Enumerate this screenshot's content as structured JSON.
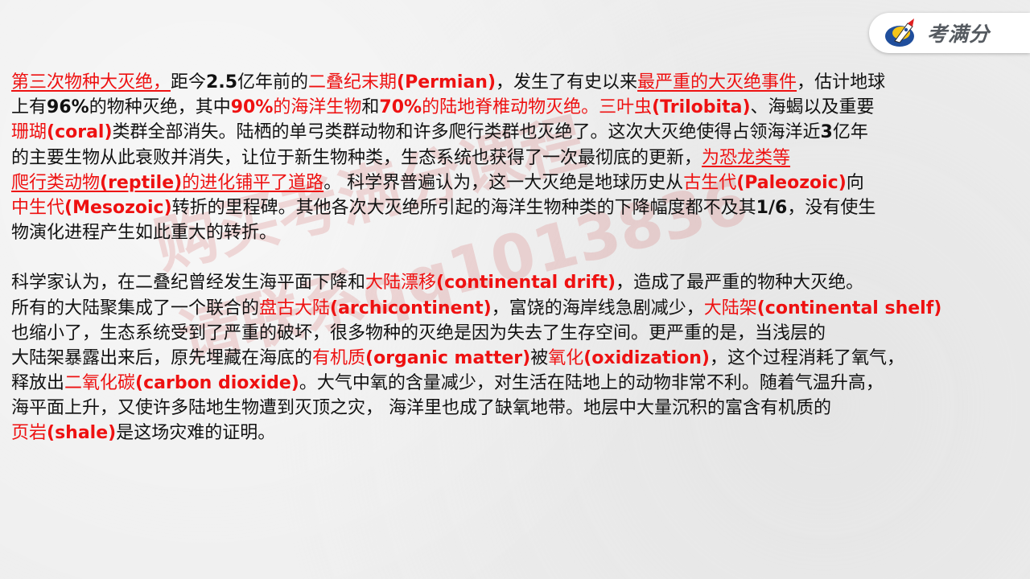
{
  "logo": {
    "text": "考满分"
  },
  "paragraph1": [
    [
      {
        "t": "第三次物种大灭绝，",
        "red": true,
        "u": true
      },
      {
        "t": "距今"
      },
      {
        "t": "2.5",
        "b": true
      },
      {
        "t": "亿年前的"
      },
      {
        "t": "二叠纪末期",
        "red": true
      },
      {
        "t": "(Permian)",
        "red": true,
        "b": true
      },
      {
        "t": "，发生了有史以来"
      },
      {
        "t": "最严重的大灭绝事件",
        "red": true,
        "u": true
      },
      {
        "t": "，估计地球"
      }
    ],
    [
      {
        "t": "上有"
      },
      {
        "t": "96%",
        "b": true
      },
      {
        "t": "的物种灭绝，其中"
      },
      {
        "t": "90%",
        "red": true,
        "b": true
      },
      {
        "t": "的海洋生物",
        "red": true
      },
      {
        "t": "和"
      },
      {
        "t": "70%",
        "red": true,
        "b": true
      },
      {
        "t": "的陆地脊椎动物灭绝。",
        "red": true
      },
      {
        "t": "三叶虫",
        "red": true
      },
      {
        "t": "(Trilobita)",
        "red": true,
        "b": true
      },
      {
        "t": "、海蝎以及重要"
      }
    ],
    [
      {
        "t": "珊瑚",
        "red": true
      },
      {
        "t": "(coral)",
        "red": true,
        "b": true
      },
      {
        "t": "类群全部消失。陆栖的单弓类群动物和许多爬行类群也灭绝了。这次大灭绝使得占领海洋近"
      },
      {
        "t": "3",
        "b": true
      },
      {
        "t": "亿年"
      }
    ],
    [
      {
        "t": "的主要生物从此衰败并消失，让位于新生物种类，生态系统也获得了一次最彻底的更新，"
      },
      {
        "t": "为恐龙类等",
        "red": true,
        "u": true
      }
    ],
    [
      {
        "t": "爬行类动物",
        "red": true,
        "u": true
      },
      {
        "t": "(reptile)",
        "red": true,
        "u": true,
        "b": true
      },
      {
        "t": "的进化铺平了道路",
        "red": true,
        "u": true
      },
      {
        "t": "。 科学界普遍认为，这一大灭绝是地球历史从"
      },
      {
        "t": "古生代",
        "red": true
      },
      {
        "t": "(Paleozoic)",
        "red": true,
        "b": true
      },
      {
        "t": "向"
      }
    ],
    [
      {
        "t": "中生代",
        "red": true
      },
      {
        "t": "(Mesozoic)",
        "red": true,
        "b": true
      },
      {
        "t": "转折的里程碑。其他各次大灭绝所引起的海洋生物种类的下降幅度都不及其"
      },
      {
        "t": "1/6",
        "b": true
      },
      {
        "t": "，没有使生"
      }
    ],
    [
      {
        "t": "物演化进程产生如此重大的转折。"
      }
    ]
  ],
  "paragraph2": [
    [
      {
        "t": "科学家认为，在二叠纪曾经发生海平面下降和"
      },
      {
        "t": "大陆漂移",
        "red": true
      },
      {
        "t": "(continental drift)",
        "red": true,
        "b": true
      },
      {
        "t": "，造成了最严重的物种大灭绝。"
      }
    ],
    [
      {
        "t": "所有的大陆聚集成了一个联合的"
      },
      {
        "t": "盘古大陆",
        "red": true
      },
      {
        "t": "(archicontinent)",
        "red": true,
        "b": true
      },
      {
        "t": "，富饶的海岸线急剧减少，"
      },
      {
        "t": "大陆架",
        "red": true
      },
      {
        "t": "(continental shelf)",
        "red": true,
        "b": true
      }
    ],
    [
      {
        "t": "也缩小了，生态系统受到了严重的破坏，很多物种的灭绝是因为失去了生存空间。更严重的是，当浅层的"
      }
    ],
    [
      {
        "t": "大陆架暴露出来后，原先埋藏在海底的"
      },
      {
        "t": "有机质",
        "red": true
      },
      {
        "t": "(organic matter)",
        "red": true,
        "b": true
      },
      {
        "t": "被"
      },
      {
        "t": "氧化",
        "red": true
      },
      {
        "t": "(oxidization)",
        "red": true,
        "b": true
      },
      {
        "t": "，这个过程消耗了氧气，"
      }
    ],
    [
      {
        "t": "释放出"
      },
      {
        "t": "二氧化碳",
        "red": true
      },
      {
        "t": "(carbon dioxide)",
        "red": true,
        "b": true
      },
      {
        "t": "。大气中氧的含量减少，对生活在陆地上的动物非常不利。随着气温升高，"
      }
    ],
    [
      {
        "t": "海平面上升，又使许多陆地生物遭到灭顶之灾， 海洋里也成了缺氧地带。地层中大量沉积的富含有机质的"
      }
    ],
    [
      {
        "t": "页岩",
        "red": true
      },
      {
        "t": "(shale)",
        "red": true,
        "b": true
      },
      {
        "t": "是这场灾难的证明。"
      }
    ]
  ],
  "watermark": {
    "line1": "购买考满分课程",
    "line2": "请联系qq1013836"
  },
  "colors": {
    "highlight": "#ee1111",
    "text": "#111111",
    "background": "#eeeeee"
  }
}
